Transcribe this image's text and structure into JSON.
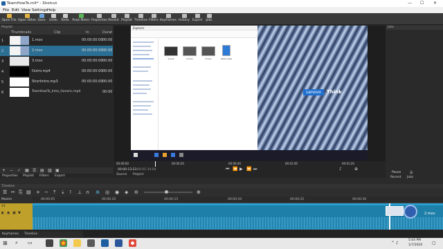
{
  "app": {
    "title": "TeamHowTo.mlt* - Shotcut",
    "win_min": "—",
    "win_max": "☐",
    "win_close": "✕"
  },
  "menu": [
    "File",
    "Edit",
    "View",
    "Settings",
    "Help"
  ],
  "toolbar": {
    "items": [
      {
        "label": "Open File",
        "icon": "folder-open-icon",
        "color": "#e0b040"
      },
      {
        "label": "Open Other",
        "icon": "open-other-icon",
        "color": "#e0b040"
      },
      {
        "label": "Save",
        "icon": "save-icon",
        "color": "#6aa0d8"
      },
      {
        "label": "Undo",
        "icon": "undo-icon",
        "color": "#cccccc"
      },
      {
        "label": "Redo",
        "icon": "redo-icon",
        "color": "#cccccc"
      },
      {
        "label": "Peak Meter",
        "icon": "peak-meter-icon",
        "color": "#5ab55a"
      },
      {
        "label": "Properties",
        "icon": "properties-icon",
        "color": "#bbbbbb"
      },
      {
        "label": "Recent",
        "icon": "recent-icon",
        "color": "#bbbbbb"
      },
      {
        "label": "Playlist",
        "icon": "playlist-icon",
        "color": "#bbbbbb"
      },
      {
        "label": "Timeline",
        "icon": "timeline-icon",
        "color": "#bbbbbb"
      },
      {
        "label": "Filters",
        "icon": "filters-icon",
        "color": "#bbbbbb"
      },
      {
        "label": "Keyframes",
        "icon": "keyframes-icon",
        "color": "#bbbbbb"
      },
      {
        "label": "History",
        "icon": "history-icon",
        "color": "#bbbbbb"
      },
      {
        "label": "Export",
        "icon": "export-icon",
        "color": "#bbbbbb"
      },
      {
        "label": "Jobs",
        "icon": "jobs-icon",
        "color": "#bbbbbb"
      }
    ]
  },
  "playlist": {
    "panel_title": "Playlist",
    "columns": {
      "thumbnails": "Thumbnails",
      "clip": "Clip",
      "in": "In",
      "duration": "Durat"
    },
    "rows": [
      {
        "num": "1",
        "clip": "1.mov",
        "in": "00:00:00:00",
        "dur": "00:00:13",
        "thumb": "#cfd6e0"
      },
      {
        "num": "2",
        "clip": "2.mov",
        "in": "00:00:00:00",
        "dur": "00:00:13",
        "thumb": "#d0d4da"
      },
      {
        "num": "3",
        "clip": "3.mov",
        "in": "00:00:00:00",
        "dur": "00:00:1",
        "thumb": "#e8e8e8"
      },
      {
        "num": "4",
        "clip": "Outro.mp4",
        "in": "00:00:00:00",
        "dur": "00:00:1",
        "thumb": "#000000"
      },
      {
        "num": "5",
        "clip": "Shortintro.mp3",
        "in": "00:00:00:00",
        "dur": "00:00:1",
        "thumb": "#ffffff"
      },
      {
        "num": "6",
        "clip": "TeamHowTo_Intro_Generic.mp4",
        "in": "00:00:00:00",
        "dur": "00:00:1",
        "thumb": "#ffffff"
      }
    ],
    "tabs": [
      "Properties",
      "Playlist",
      "Filters",
      "Export"
    ]
  },
  "viewer": {
    "explorer_title": "Explorer",
    "current_time": "00:00:13:23",
    "total_time": "00:01:34:04",
    "ruler": [
      "00:00:00",
      "00:00:20",
      "00:00:40",
      "00:01:00",
      "00:01:20"
    ],
    "brand_lenovo": "Lenovo",
    "brand_think": "Think",
    "tabs": [
      "Source",
      "Project"
    ],
    "files": [
      "1.mov",
      "2.mov",
      "3.mov",
      "Outro.mp4"
    ]
  },
  "jobs": {
    "panel_title": "Jobs",
    "pause_label": "Pause",
    "tabs": [
      "Recent",
      "Jobs"
    ]
  },
  "timeline": {
    "panel_title": "Timeline",
    "master_label": "Master",
    "track_label": "V1",
    "ruler": [
      "00:00:05",
      "00:00:10",
      "00:00:15",
      "00:00:20",
      "00:00:25",
      "00:00:30"
    ],
    "clip_label": "2.mov",
    "tabs": [
      "Keyframes",
      "Timeline"
    ]
  },
  "windows": {
    "time": "5:04 PM",
    "date": "1/7/2020"
  }
}
